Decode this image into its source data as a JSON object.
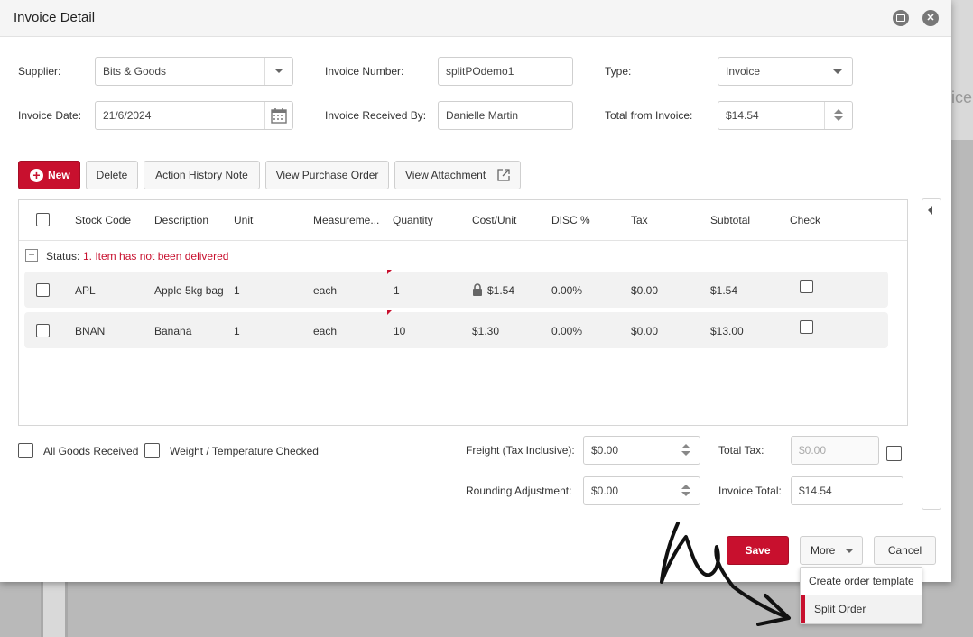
{
  "window": {
    "title": "Invoice Detail"
  },
  "background": {
    "peek_text": "ice"
  },
  "form": {
    "supplier_label": "Supplier:",
    "supplier_value": "Bits & Goods",
    "invoice_number_label": "Invoice Number:",
    "invoice_number_value": "splitPOdemo1",
    "type_label": "Type:",
    "type_value": "Invoice",
    "invoice_date_label": "Invoice Date:",
    "invoice_date_value": "21/6/2024",
    "received_by_label": "Invoice Received By:",
    "received_by_value": "Danielle Martin",
    "total_from_invoice_label": "Total from Invoice:",
    "total_from_invoice_value": "$14.54"
  },
  "toolbar": {
    "new_label": "New",
    "delete_label": "Delete",
    "action_history_label": "Action History Note",
    "view_po_label": "View Purchase Order",
    "view_attachment_label": "View Attachment"
  },
  "grid": {
    "columns": [
      "Stock Code",
      "Description",
      "Unit",
      "Measureme...",
      "Quantity",
      "Cost/Unit",
      "DISC %",
      "Tax",
      "Subtotal",
      "Check"
    ],
    "status_label": "Status:",
    "status_value": "1. Item has not been delivered",
    "rows": [
      {
        "stock_code": "APL",
        "description": "Apple 5kg bag",
        "unit": "1",
        "measurement": "each",
        "quantity": "1",
        "cost_unit": "$1.54",
        "disc": "0.00%",
        "tax": "$0.00",
        "subtotal": "$1.54",
        "locked": true
      },
      {
        "stock_code": "BNAN",
        "description": "Banana",
        "unit": "1",
        "measurement": "each",
        "quantity": "10",
        "cost_unit": "$1.30",
        "disc": "0.00%",
        "tax": "$0.00",
        "subtotal": "$13.00",
        "locked": false
      }
    ]
  },
  "footer": {
    "all_goods_received_label": "All Goods Received",
    "weight_temp_label": "Weight / Temperature Checked",
    "freight_label": "Freight (Tax Inclusive):",
    "freight_value": "$0.00",
    "rounding_label": "Rounding Adjustment:",
    "rounding_value": "$0.00",
    "total_tax_label": "Total Tax:",
    "total_tax_value": "$0.00",
    "invoice_total_label": "Invoice Total:",
    "invoice_total_value": "$14.54"
  },
  "actions": {
    "save_label": "Save",
    "more_label": "More",
    "cancel_label": "Cancel"
  },
  "more_menu": {
    "items": [
      "Create order template",
      "Split Order"
    ]
  },
  "colors": {
    "accent": "#c8102e"
  }
}
